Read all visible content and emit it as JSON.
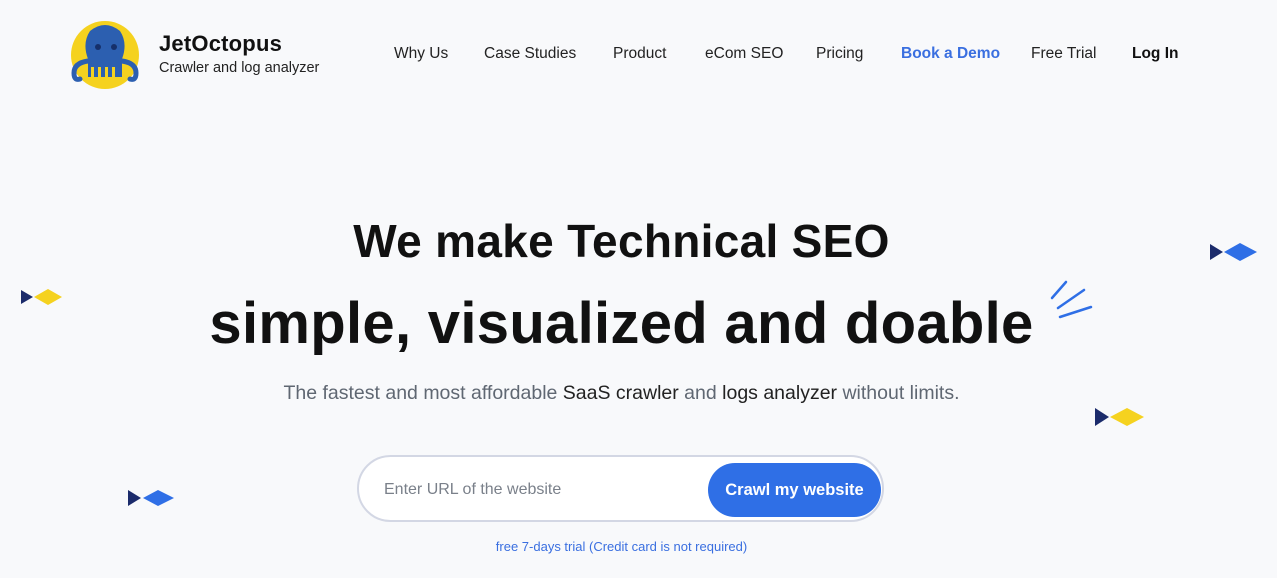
{
  "brand": {
    "name": "JetOctopus",
    "tagline": "Crawler and log analyzer",
    "logo_icon": "octopus-logo-icon"
  },
  "nav": {
    "items": [
      {
        "label": "Why Us"
      },
      {
        "label": "Case Studies"
      },
      {
        "label": "Product"
      },
      {
        "label": "eCom SEO"
      },
      {
        "label": "Pricing"
      },
      {
        "label": "Book a Demo"
      },
      {
        "label": "Free Trial"
      },
      {
        "label": "Log In"
      }
    ]
  },
  "hero": {
    "line1": "We make Technical SEO",
    "line2": "simple, visualized and doable",
    "sub_part1": "The fastest and most affordable ",
    "sub_part2": "SaaS crawler",
    "sub_part3": " and ",
    "sub_part4": "logs analyzer",
    "sub_part5": " without limits."
  },
  "form": {
    "url_placeholder": "Enter URL of the website",
    "url_value": "",
    "submit_label": "Crawl my website",
    "note": "free 7-days trial (Credit card is not required)"
  },
  "colors": {
    "accent": "#2f6fe6",
    "accent_text": "#3a6fe0",
    "yellow": "#f5d21f",
    "navy": "#1b2b6b",
    "background": "#f8f9fb"
  }
}
